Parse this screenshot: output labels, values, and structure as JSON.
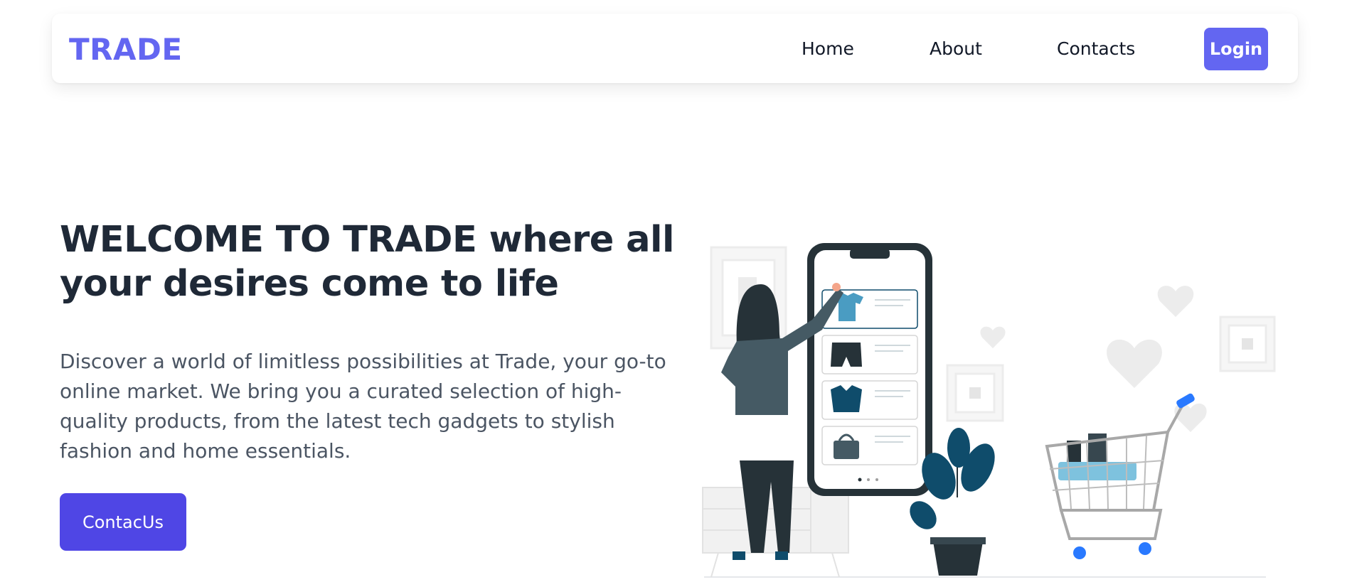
{
  "navbar": {
    "logo": "TRADE",
    "links": [
      {
        "label": "Home"
      },
      {
        "label": "About"
      },
      {
        "label": "Contacts"
      }
    ],
    "login_label": "Login"
  },
  "hero": {
    "title": "WELCOME TO TRADE where all your desires come to life",
    "description": "Discover a world of limitless possibilities at Trade, your go-to online market. We bring you a curated selection of high-quality products, from the latest tech gadgets to stylish fashion and home essentials.",
    "cta_label": "ContacUs"
  },
  "colors": {
    "brand": "#6366f1",
    "cta": "#4f46e5",
    "heading": "#1f2937",
    "body_text": "#4b5563",
    "illustration_dark": "#263238",
    "illustration_accent": "#0f4c6b"
  },
  "illustration": {
    "name": "online-shopping-illustration",
    "icons": [
      "phone-icon",
      "shopping-cart-icon",
      "plant-icon",
      "heart-icon",
      "woman-figure"
    ]
  }
}
